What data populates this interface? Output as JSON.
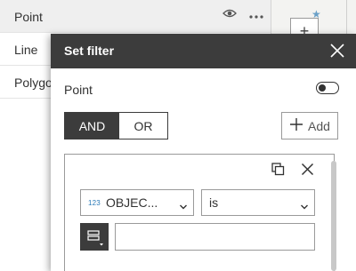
{
  "layer_list": {
    "items": [
      {
        "label": "Point"
      },
      {
        "label": "Line"
      },
      {
        "label": "Polygo"
      }
    ],
    "row_icons": [
      "eye-icon",
      "more-icon"
    ]
  },
  "map": {
    "zoom_in_icon": "plus-icon",
    "marker_icon": "star-icon"
  },
  "dialog": {
    "title": "Set filter",
    "close_icon": "close-icon",
    "layer_name": "Point",
    "toggle_on": false,
    "logic": {
      "options": [
        "AND",
        "OR"
      ],
      "selected": "AND"
    },
    "add_label": "Add",
    "clause": {
      "card_icons": [
        "copy-icon",
        "close-icon"
      ],
      "field_type_icon": "123",
      "field_value": "OBJEC...",
      "operator_value": "is",
      "value_type_icon": "list-icon",
      "value_input": ""
    }
  },
  "colors": {
    "header": "#3c3c3c",
    "accent": "#2a7ab8",
    "border": "#9a9a9a"
  }
}
